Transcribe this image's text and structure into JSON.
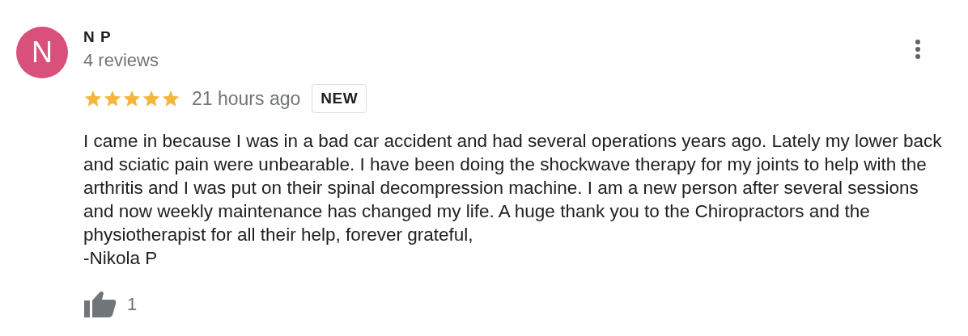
{
  "review": {
    "avatar_letter": "N",
    "author": "N P",
    "author_meta": "4 reviews",
    "stars": 5,
    "time": "21 hours ago",
    "badge": "NEW",
    "text": "I came in because I was in a bad car accident and had several operations years ago. Lately my lower back and sciatic pain were unbearable. I have been doing the shockwave therapy for my joints to help with the arthritis and I was put on their spinal decompression machine. I am a new person after several sessions and now weekly maintenance has changed my life. A huge thank you to the Chiropractors and the physiotherapist for all their help, forever grateful,",
    "signature": "-Nikola P",
    "likes": "1"
  }
}
